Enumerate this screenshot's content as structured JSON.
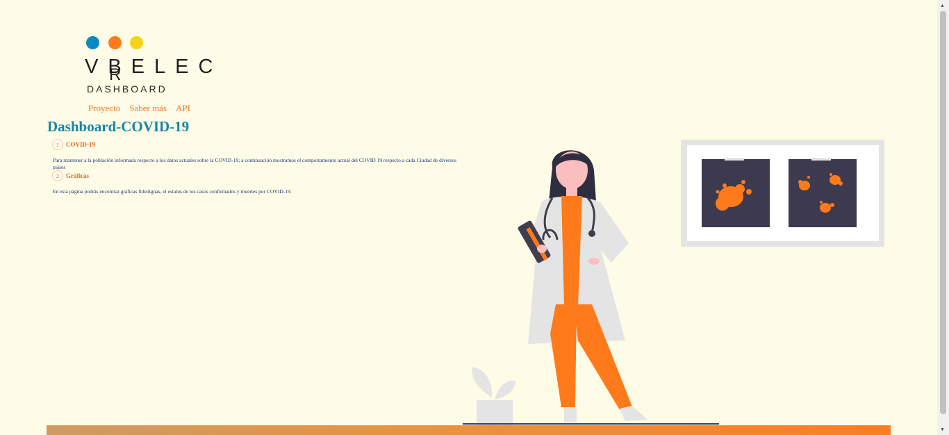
{
  "logo": {
    "dots": [
      "#0a8bbf",
      "#ff7a1a",
      "#f6d318"
    ],
    "brand": "VBELEC",
    "brand_overlay": "R",
    "subtitle": "DASHBOARD"
  },
  "nav": [
    {
      "label": "Proyecto"
    },
    {
      "label": "Saber más"
    },
    {
      "label": "API"
    }
  ],
  "page_title": "Dashboard-COVID-19",
  "steps": [
    {
      "number": "1",
      "title": "COVID-19",
      "text": "Para mantener a la población informada respecto a los datos actuales sobre la COVID-19; a continuación mostramos el comportamiento actual del COVID 19 respecto a cada Ciudad de diversos paises"
    },
    {
      "number": "2",
      "title": "Gráficas",
      "text": "En esta página podrás encontrar gráficas fidedignas, el estatus de los casos confirmados y muertes por COVID-19."
    }
  ],
  "colors": {
    "background": "#fefbe6",
    "accent_orange": "#ff7a1a",
    "title_blue": "#1286a9",
    "dark_panel": "#3d3a4f"
  }
}
